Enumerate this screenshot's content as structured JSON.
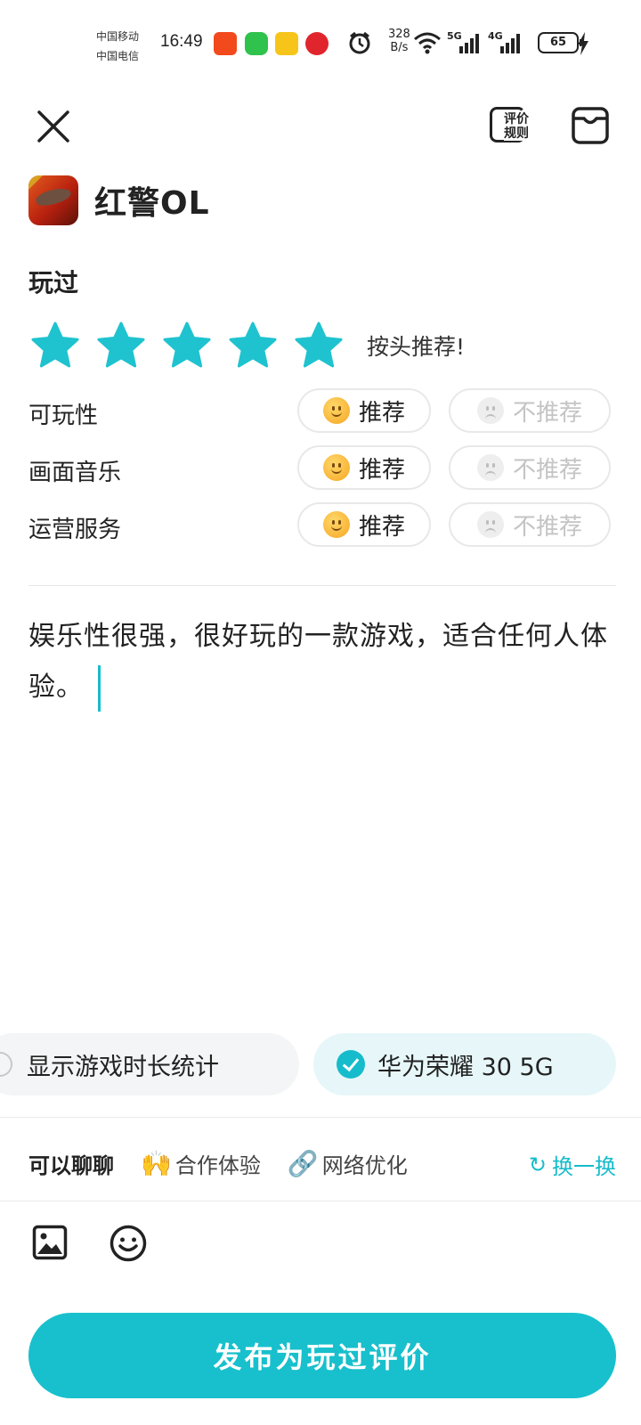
{
  "status_bar": {
    "carrier_1": "中国移动",
    "carrier_2": "中国电信",
    "time": "16:49",
    "net_speed_value": "328",
    "net_speed_unit": "B/s",
    "sig1_label": "5G",
    "sig2_label": "4G",
    "battery": "65",
    "app_icons": [
      "taobao-icon",
      "wechat-icon",
      "meituan-icon",
      "pinduoduo-icon"
    ]
  },
  "header": {
    "rules_label_line1": "评价",
    "rules_label_line2": "规则"
  },
  "game": {
    "name": "红警OL"
  },
  "status_label": "玩过",
  "rating": {
    "stars": 5,
    "max": 5,
    "text": "按头推荐!"
  },
  "criteria": [
    {
      "label": "可玩性",
      "yes": "推荐",
      "no": "不推荐",
      "selected": "yes"
    },
    {
      "label": "画面音乐",
      "yes": "推荐",
      "no": "不推荐",
      "selected": "yes"
    },
    {
      "label": "运营服务",
      "yes": "推荐",
      "no": "不推荐",
      "selected": "yes"
    }
  ],
  "review": {
    "text": "娱乐性很强，很好玩的一款游戏，适合任何人体验。"
  },
  "options": {
    "show_duration": "显示游戏时长统计",
    "device": "华为荣耀 30 5G"
  },
  "topics": {
    "lead": "可以聊聊",
    "items": [
      {
        "icon": "raised-hands-icon",
        "label": "合作体验"
      },
      {
        "icon": "link-icon",
        "label": "网络优化"
      }
    ],
    "refresh": "换一换"
  },
  "publish_label": "发布为玩过评价",
  "colors": {
    "accent": "#16BCCB",
    "star": "#1EC3CF",
    "publish_bg": "#17C0CC"
  }
}
